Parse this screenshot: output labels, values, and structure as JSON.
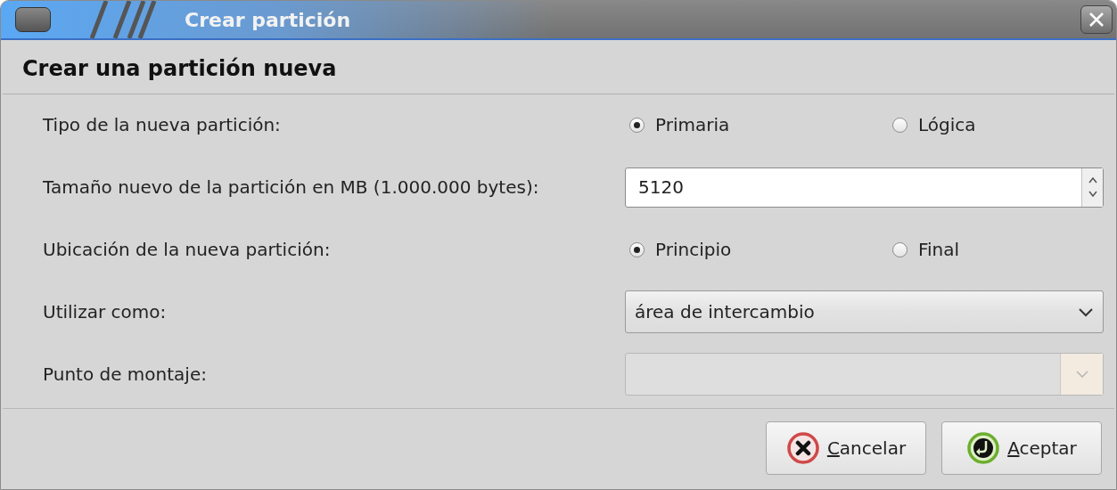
{
  "window": {
    "title": "Crear partición"
  },
  "heading": "Crear una partición nueva",
  "rows": [
    {
      "kind": "radio",
      "label": "Tipo de la nueva partición:",
      "options": [
        {
          "label": "Primaria",
          "selected": true
        },
        {
          "label": "Lógica",
          "selected": false
        }
      ]
    },
    {
      "kind": "spin",
      "label": "Tamaño nuevo de la partición en MB (1.000.000 bytes):",
      "value": "5120"
    },
    {
      "kind": "radio",
      "label": "Ubicación de la nueva partición:",
      "options": [
        {
          "label": "Principio",
          "selected": true
        },
        {
          "label": "Final",
          "selected": false
        }
      ]
    },
    {
      "kind": "combo",
      "label": "Utilizar como:",
      "value": "área de intercambio",
      "disabled": false
    },
    {
      "kind": "combo",
      "label": "Punto de montaje:",
      "disabled": true
    }
  ],
  "buttons": [
    {
      "kind": "cancel",
      "label": "Cancelar",
      "underline_first": true
    },
    {
      "kind": "accept",
      "label": "Aceptar",
      "underline_first": true
    }
  ]
}
